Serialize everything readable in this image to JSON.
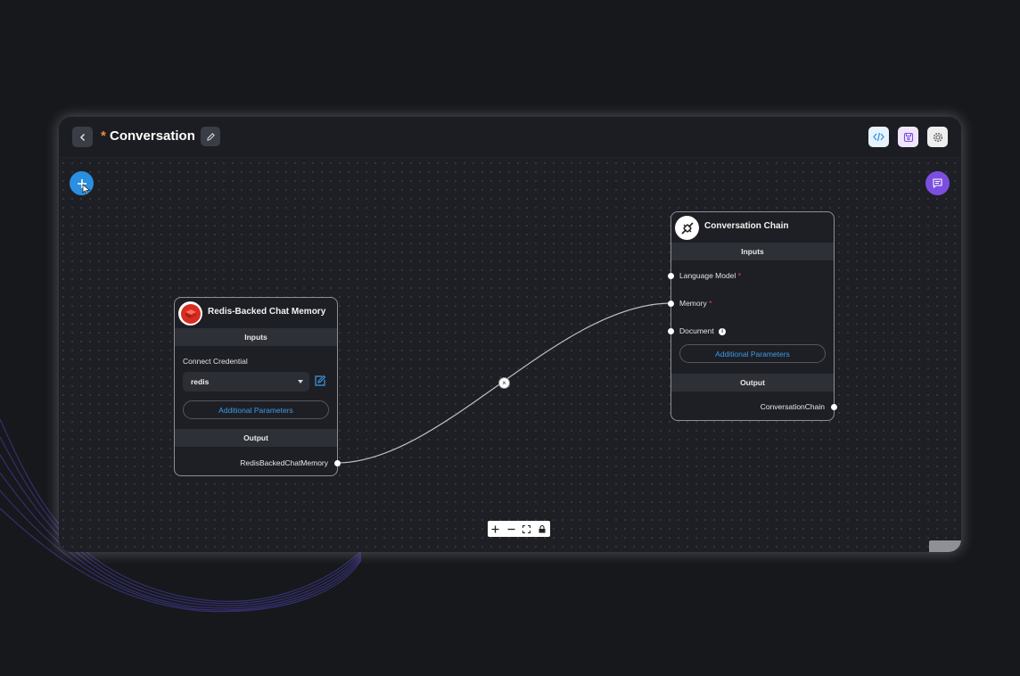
{
  "header": {
    "title": "Conversation",
    "unsaved_marker": "*"
  },
  "nodes": {
    "memory": {
      "title": "Redis-Backed Chat Memory",
      "inputs_label": "Inputs",
      "credential_label": "Connect Credential",
      "credential_value": "redis",
      "additional_params": "Additional Parameters",
      "output_label": "Output",
      "output_name": "RedisBackedChatMemory"
    },
    "chain": {
      "title": "Conversation Chain",
      "inputs_label": "Inputs",
      "input_language_model": "Language Model",
      "input_memory": "Memory",
      "input_document": "Document",
      "required_marker": "*",
      "info_marker": "i",
      "additional_params": "Additional Parameters",
      "output_label": "Output",
      "output_name": "ConversationChain"
    }
  },
  "edge": {
    "delete_symbol": "×"
  },
  "colors": {
    "accent_blue": "#2a8fe0",
    "accent_purple": "#7c4ee0",
    "link_blue": "#3c9be8",
    "required_red": "#e5484d"
  },
  "icons": {
    "back": "chevron-left-icon",
    "edit": "pencil-icon",
    "code": "code-icon",
    "save": "save-icon",
    "settings": "gear-icon",
    "add": "plus-icon",
    "chat": "chat-icon"
  }
}
